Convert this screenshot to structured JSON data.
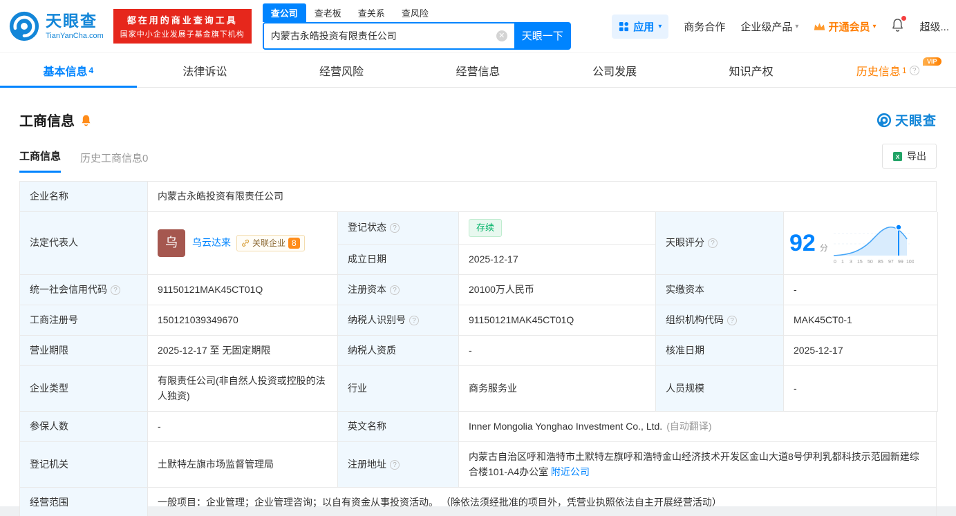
{
  "colors": {
    "primary_blue": "#0084ff",
    "brand_blue": "#1386d8",
    "promo_red": "#e6271c",
    "vip_orange": "#ff8000",
    "status_green": "#00b267",
    "label_cell_bg": "#f0f8fe"
  },
  "header": {
    "logo": {
      "brand": "天眼查",
      "domain": "TianYanCha.com"
    },
    "promo": {
      "line1": "都在用的商业查询工具",
      "line2": "国家中小企业发展子基金旗下机构"
    },
    "search": {
      "tabs": [
        {
          "label": "查公司"
        },
        {
          "label": "查老板"
        },
        {
          "label": "查关系"
        },
        {
          "label": "查风险"
        }
      ],
      "value": "内蒙古永皓投资有限责任公司",
      "button": "天眼一下"
    },
    "nav": {
      "apps": "应用",
      "cooperation": "商务合作",
      "enterprise": "企业级产品",
      "vip": "开通会员",
      "super": "超级..."
    }
  },
  "tabs": [
    {
      "label": "基本信息",
      "count": "4"
    },
    {
      "label": "法律诉讼"
    },
    {
      "label": "经营风险"
    },
    {
      "label": "经营信息"
    },
    {
      "label": "公司发展"
    },
    {
      "label": "知识产权"
    },
    {
      "label": "历史信息",
      "count": "1",
      "vip_label": "VIP"
    }
  ],
  "section": {
    "title": "工商信息",
    "brand": "天眼查",
    "subtabs": [
      {
        "label": "工商信息"
      },
      {
        "label": "历史工商信息0"
      }
    ],
    "export_label": "导出"
  },
  "table": {
    "rows": {
      "company_name": {
        "label": "企业名称",
        "value": "内蒙古永皓投资有限责任公司"
      },
      "legal_rep": {
        "label": "法定代表人",
        "avatar": "乌",
        "name": "乌云达来",
        "related_label": "关联企业",
        "related_count": "8"
      },
      "reg_status": {
        "label": "登记状态",
        "value": "存续"
      },
      "establish_date": {
        "label": "成立日期",
        "value": "2025-12-17"
      },
      "score": {
        "label": "天眼评分",
        "value": "92",
        "unit": "分",
        "axis": [
          "0",
          "1",
          "3",
          "15",
          "50",
          "85",
          "97",
          "99",
          "100"
        ]
      },
      "credit_code": {
        "label": "统一社会信用代码",
        "value": "91150121MAK45CT01Q"
      },
      "reg_capital": {
        "label": "注册资本",
        "value": "20100万人民币"
      },
      "paid_capital": {
        "label": "实缴资本",
        "value": "-"
      },
      "reg_number": {
        "label": "工商注册号",
        "value": "150121039349670"
      },
      "taxpayer_id": {
        "label": "纳税人识别号",
        "value": "91150121MAK45CT01Q"
      },
      "org_code": {
        "label": "组织机构代码",
        "value": "MAK45CT0-1"
      },
      "business_term": {
        "label": "营业期限",
        "value": "2025-12-17 至 无固定期限"
      },
      "taxpayer_quality": {
        "label": "纳税人资质",
        "value": "-"
      },
      "approval_date": {
        "label": "核准日期",
        "value": "2025-12-17"
      },
      "company_type": {
        "label": "企业类型",
        "value": "有限责任公司(非自然人投资或控股的法人独资)"
      },
      "industry": {
        "label": "行业",
        "value": "商务服务业"
      },
      "staff_size": {
        "label": "人员规模",
        "value": "-"
      },
      "insured_count": {
        "label": "参保人数",
        "value": "-"
      },
      "english_name": {
        "label": "英文名称",
        "value": "Inner Mongolia Yonghao Investment Co., Ltd.",
        "note": "(自动翻译)"
      },
      "reg_authority": {
        "label": "登记机关",
        "value": "土默特左旗市场监督管理局"
      },
      "reg_address": {
        "label": "注册地址",
        "value": "内蒙古自治区呼和浩特市土默特左旗呼和浩特金山经济技术开发区金山大道8号伊利乳都科技示范园新建综合楼101-A4办公室",
        "link": "附近公司"
      },
      "business_scope": {
        "label": "经营范围",
        "value": "一般项目：企业管理；企业管理咨询；以自有资金从事投资活动。 （除依法须经批准的项目外，凭营业执照依法自主开展经营活动）"
      }
    }
  }
}
